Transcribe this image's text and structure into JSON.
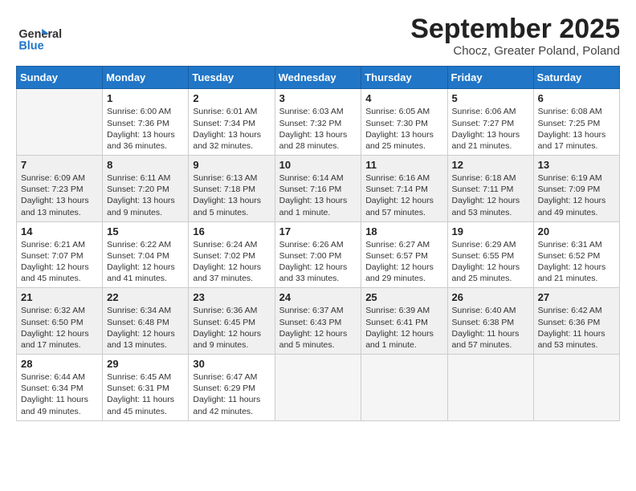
{
  "header": {
    "logo_line1": "General",
    "logo_line2": "Blue",
    "month_title": "September 2025",
    "location": "Chocz, Greater Poland, Poland"
  },
  "weekdays": [
    "Sunday",
    "Monday",
    "Tuesday",
    "Wednesday",
    "Thursday",
    "Friday",
    "Saturday"
  ],
  "weeks": [
    [
      {
        "date": "",
        "info": ""
      },
      {
        "date": "1",
        "info": "Sunrise: 6:00 AM\nSunset: 7:36 PM\nDaylight: 13 hours\nand 36 minutes."
      },
      {
        "date": "2",
        "info": "Sunrise: 6:01 AM\nSunset: 7:34 PM\nDaylight: 13 hours\nand 32 minutes."
      },
      {
        "date": "3",
        "info": "Sunrise: 6:03 AM\nSunset: 7:32 PM\nDaylight: 13 hours\nand 28 minutes."
      },
      {
        "date": "4",
        "info": "Sunrise: 6:05 AM\nSunset: 7:30 PM\nDaylight: 13 hours\nand 25 minutes."
      },
      {
        "date": "5",
        "info": "Sunrise: 6:06 AM\nSunset: 7:27 PM\nDaylight: 13 hours\nand 21 minutes."
      },
      {
        "date": "6",
        "info": "Sunrise: 6:08 AM\nSunset: 7:25 PM\nDaylight: 13 hours\nand 17 minutes."
      }
    ],
    [
      {
        "date": "7",
        "info": "Sunrise: 6:09 AM\nSunset: 7:23 PM\nDaylight: 13 hours\nand 13 minutes."
      },
      {
        "date": "8",
        "info": "Sunrise: 6:11 AM\nSunset: 7:20 PM\nDaylight: 13 hours\nand 9 minutes."
      },
      {
        "date": "9",
        "info": "Sunrise: 6:13 AM\nSunset: 7:18 PM\nDaylight: 13 hours\nand 5 minutes."
      },
      {
        "date": "10",
        "info": "Sunrise: 6:14 AM\nSunset: 7:16 PM\nDaylight: 13 hours\nand 1 minute."
      },
      {
        "date": "11",
        "info": "Sunrise: 6:16 AM\nSunset: 7:14 PM\nDaylight: 12 hours\nand 57 minutes."
      },
      {
        "date": "12",
        "info": "Sunrise: 6:18 AM\nSunset: 7:11 PM\nDaylight: 12 hours\nand 53 minutes."
      },
      {
        "date": "13",
        "info": "Sunrise: 6:19 AM\nSunset: 7:09 PM\nDaylight: 12 hours\nand 49 minutes."
      }
    ],
    [
      {
        "date": "14",
        "info": "Sunrise: 6:21 AM\nSunset: 7:07 PM\nDaylight: 12 hours\nand 45 minutes."
      },
      {
        "date": "15",
        "info": "Sunrise: 6:22 AM\nSunset: 7:04 PM\nDaylight: 12 hours\nand 41 minutes."
      },
      {
        "date": "16",
        "info": "Sunrise: 6:24 AM\nSunset: 7:02 PM\nDaylight: 12 hours\nand 37 minutes."
      },
      {
        "date": "17",
        "info": "Sunrise: 6:26 AM\nSunset: 7:00 PM\nDaylight: 12 hours\nand 33 minutes."
      },
      {
        "date": "18",
        "info": "Sunrise: 6:27 AM\nSunset: 6:57 PM\nDaylight: 12 hours\nand 29 minutes."
      },
      {
        "date": "19",
        "info": "Sunrise: 6:29 AM\nSunset: 6:55 PM\nDaylight: 12 hours\nand 25 minutes."
      },
      {
        "date": "20",
        "info": "Sunrise: 6:31 AM\nSunset: 6:52 PM\nDaylight: 12 hours\nand 21 minutes."
      }
    ],
    [
      {
        "date": "21",
        "info": "Sunrise: 6:32 AM\nSunset: 6:50 PM\nDaylight: 12 hours\nand 17 minutes."
      },
      {
        "date": "22",
        "info": "Sunrise: 6:34 AM\nSunset: 6:48 PM\nDaylight: 12 hours\nand 13 minutes."
      },
      {
        "date": "23",
        "info": "Sunrise: 6:36 AM\nSunset: 6:45 PM\nDaylight: 12 hours\nand 9 minutes."
      },
      {
        "date": "24",
        "info": "Sunrise: 6:37 AM\nSunset: 6:43 PM\nDaylight: 12 hours\nand 5 minutes."
      },
      {
        "date": "25",
        "info": "Sunrise: 6:39 AM\nSunset: 6:41 PM\nDaylight: 12 hours\nand 1 minute."
      },
      {
        "date": "26",
        "info": "Sunrise: 6:40 AM\nSunset: 6:38 PM\nDaylight: 11 hours\nand 57 minutes."
      },
      {
        "date": "27",
        "info": "Sunrise: 6:42 AM\nSunset: 6:36 PM\nDaylight: 11 hours\nand 53 minutes."
      }
    ],
    [
      {
        "date": "28",
        "info": "Sunrise: 6:44 AM\nSunset: 6:34 PM\nDaylight: 11 hours\nand 49 minutes."
      },
      {
        "date": "29",
        "info": "Sunrise: 6:45 AM\nSunset: 6:31 PM\nDaylight: 11 hours\nand 45 minutes."
      },
      {
        "date": "30",
        "info": "Sunrise: 6:47 AM\nSunset: 6:29 PM\nDaylight: 11 hours\nand 42 minutes."
      },
      {
        "date": "",
        "info": ""
      },
      {
        "date": "",
        "info": ""
      },
      {
        "date": "",
        "info": ""
      },
      {
        "date": "",
        "info": ""
      }
    ]
  ]
}
